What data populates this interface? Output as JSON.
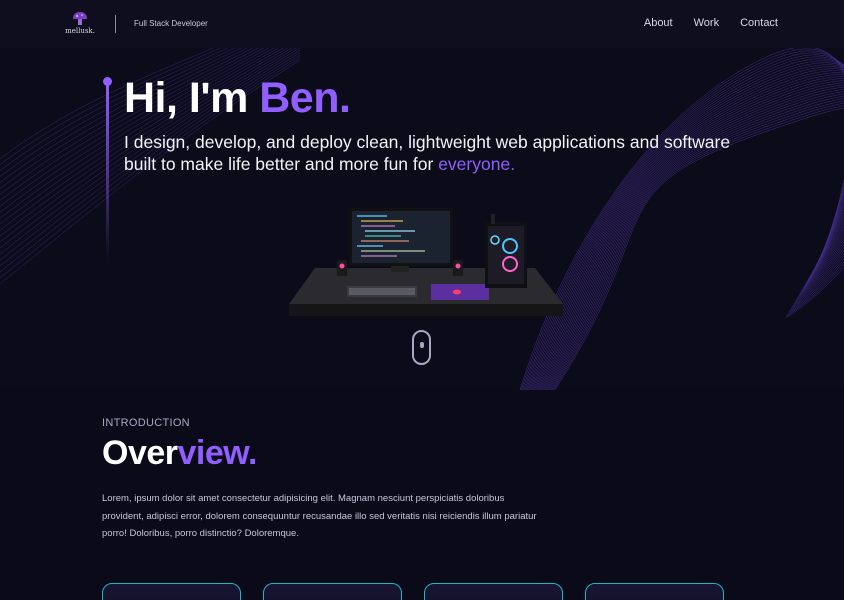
{
  "nav": {
    "logo_text": "mellusk.",
    "role": "Full Stack Developer",
    "links": [
      "About",
      "Work",
      "Contact"
    ]
  },
  "hero": {
    "greeting": "Hi, I'm ",
    "name": "Ben.",
    "subtitle": "I design, develop, and deploy clean, lightweight web applications and software built to make life better and more fun for ",
    "subtitle_highlight": "everyone."
  },
  "overview": {
    "label": "INTRODUCTION",
    "title_part1": "Over",
    "title_part2": "view.",
    "body": "Lorem, ipsum dolor sit amet consectetur adipisicing elit. Magnam nesciunt perspiciatis doloribus provident, adipisci error, dolorem consequuntur recusandae illo sed veritatis nisi reiciendis illum pariatur porro! Doloribus, porro distinctio? Doloremque."
  },
  "colors": {
    "accent": "#915eff",
    "background": "#0b0a18",
    "card_border": "#1fb5c8"
  },
  "icons": [
    "mushroom-logo-icon",
    "scroll-mouse-icon"
  ]
}
